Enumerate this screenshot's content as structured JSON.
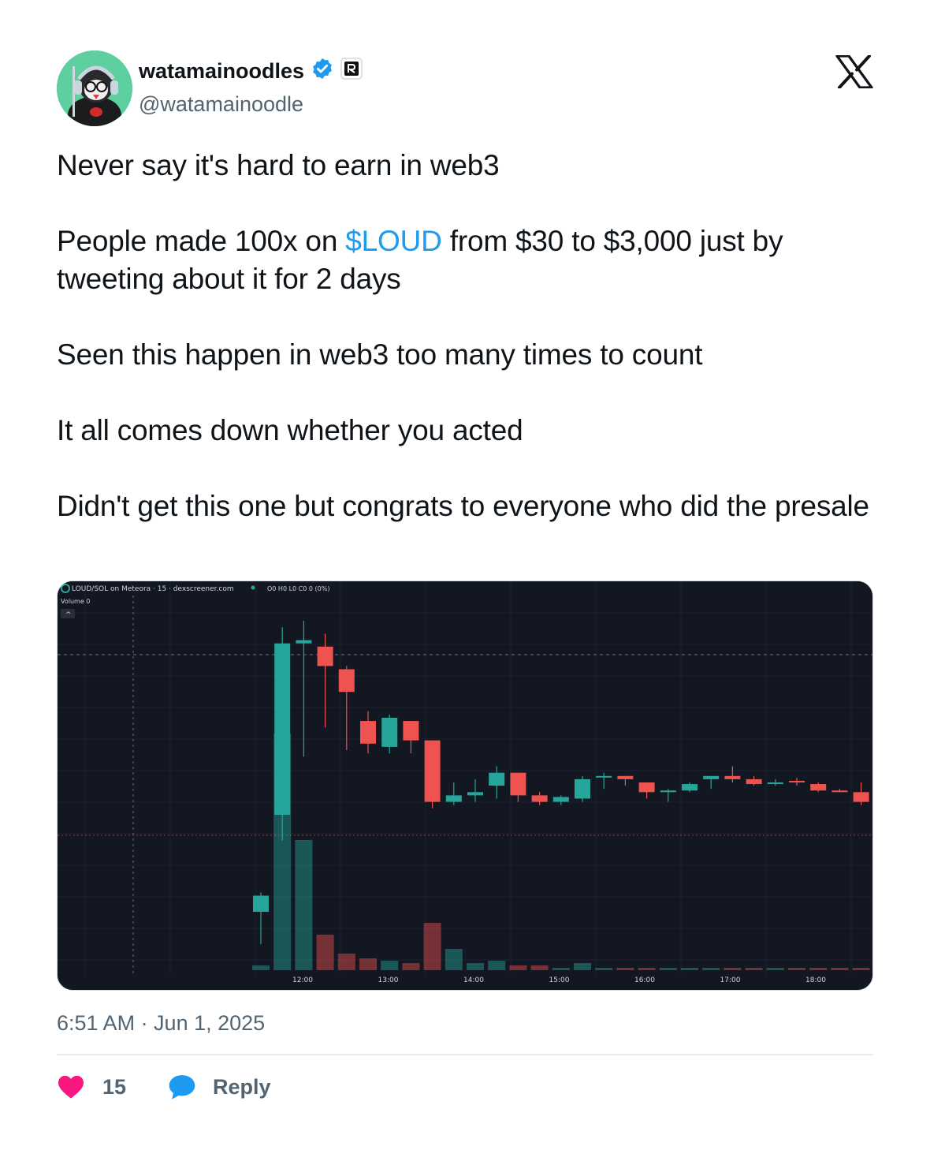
{
  "user": {
    "display_name": "watamainoodles",
    "handle": "@watamainoodle",
    "verified_color": "#1d9bf0",
    "icons": [
      "avatar-penguin",
      "verified-badge-icon",
      "affiliate-badge-icon"
    ]
  },
  "x_logo": "x-logo-icon",
  "tweet": {
    "line1": "Never say it's hard to earn in web3",
    "p2_before": "People made 100x on ",
    "p2_cashtag": "$LOUD",
    "p2_after": " from $30 to $3,000 just by tweeting about it for 2 days",
    "line3": "Seen this happen in web3 too many times to count",
    "line4": "It all comes down whether you acted",
    "line5": "Didn't get this one but congrats to everyone who did the presale",
    "cashtag_color": "#1d9bf0"
  },
  "chart_header": {
    "pair": "LOUD/SOL on Meteora · 15 · dexscreener.com",
    "ohlc": "O0 H0 L0 C0 0 (0%)",
    "volume": "Volume  0",
    "collapse": "^"
  },
  "chart_data": {
    "type": "candlestick",
    "x_ticks": [
      "12:00",
      "13:00",
      "14:00",
      "15:00",
      "16:00",
      "17:00",
      "18:00"
    ],
    "up_color": "#26a69a",
    "down_color": "#ef5350",
    "background": "#131722",
    "grid": true,
    "candles": [
      {
        "o": 1.0,
        "h": 1.6,
        "l": 0.0,
        "c": 1.5,
        "dir": "up"
      },
      {
        "o": 4.0,
        "h": 9.8,
        "l": 3.2,
        "c": 9.3,
        "dir": "up"
      },
      {
        "o": 9.3,
        "h": 10.0,
        "l": 5.8,
        "c": 9.4,
        "dir": "up"
      },
      {
        "o": 9.2,
        "h": 9.6,
        "l": 6.7,
        "c": 8.6,
        "dir": "down"
      },
      {
        "o": 8.5,
        "h": 8.6,
        "l": 6.0,
        "c": 7.8,
        "dir": "down"
      },
      {
        "o": 6.9,
        "h": 7.2,
        "l": 5.9,
        "c": 6.2,
        "dir": "down"
      },
      {
        "o": 6.1,
        "h": 7.1,
        "l": 5.9,
        "c": 7.0,
        "dir": "up"
      },
      {
        "o": 6.9,
        "h": 6.9,
        "l": 5.9,
        "c": 6.3,
        "dir": "down"
      },
      {
        "o": 6.3,
        "h": 6.3,
        "l": 4.2,
        "c": 4.4,
        "dir": "down"
      },
      {
        "o": 4.4,
        "h": 5.0,
        "l": 4.3,
        "c": 4.6,
        "dir": "up"
      },
      {
        "o": 4.6,
        "h": 5.1,
        "l": 4.4,
        "c": 4.7,
        "dir": "up"
      },
      {
        "o": 4.9,
        "h": 5.5,
        "l": 4.5,
        "c": 5.3,
        "dir": "up"
      },
      {
        "o": 5.3,
        "h": 5.3,
        "l": 4.4,
        "c": 4.6,
        "dir": "down"
      },
      {
        "o": 4.6,
        "h": 4.7,
        "l": 4.3,
        "c": 4.4,
        "dir": "down"
      },
      {
        "o": 4.4,
        "h": 4.6,
        "l": 4.3,
        "c": 4.55,
        "dir": "up"
      },
      {
        "o": 4.5,
        "h": 5.2,
        "l": 4.4,
        "c": 5.1,
        "dir": "up"
      },
      {
        "o": 5.15,
        "h": 5.3,
        "l": 4.8,
        "c": 5.2,
        "dir": "up"
      },
      {
        "o": 5.2,
        "h": 5.2,
        "l": 4.9,
        "c": 5.1,
        "dir": "down"
      },
      {
        "o": 5.0,
        "h": 5.0,
        "l": 4.5,
        "c": 4.7,
        "dir": "down"
      },
      {
        "o": 4.7,
        "h": 4.8,
        "l": 4.4,
        "c": 4.75,
        "dir": "up"
      },
      {
        "o": 4.75,
        "h": 5.0,
        "l": 4.7,
        "c": 4.95,
        "dir": "up"
      },
      {
        "o": 5.1,
        "h": 5.2,
        "l": 4.8,
        "c": 5.2,
        "dir": "up"
      },
      {
        "o": 5.2,
        "h": 5.5,
        "l": 5.0,
        "c": 5.1,
        "dir": "down"
      },
      {
        "o": 5.1,
        "h": 5.2,
        "l": 4.9,
        "c": 4.95,
        "dir": "down"
      },
      {
        "o": 4.95,
        "h": 5.1,
        "l": 4.9,
        "c": 5.0,
        "dir": "up"
      },
      {
        "o": 5.05,
        "h": 5.15,
        "l": 4.9,
        "c": 5.0,
        "dir": "down"
      },
      {
        "o": 4.95,
        "h": 5.0,
        "l": 4.7,
        "c": 4.75,
        "dir": "down"
      },
      {
        "o": 4.75,
        "h": 4.8,
        "l": 4.7,
        "c": 4.72,
        "dir": "down"
      },
      {
        "o": 4.7,
        "h": 5.0,
        "l": 4.3,
        "c": 4.4,
        "dir": "down"
      }
    ],
    "volumes": [
      {
        "v": 0.02,
        "dir": "up"
      },
      {
        "v": 1.0,
        "dir": "up"
      },
      {
        "v": 0.55,
        "dir": "up"
      },
      {
        "v": 0.15,
        "dir": "down"
      },
      {
        "v": 0.07,
        "dir": "down"
      },
      {
        "v": 0.05,
        "dir": "down"
      },
      {
        "v": 0.04,
        "dir": "up"
      },
      {
        "v": 0.03,
        "dir": "down"
      },
      {
        "v": 0.2,
        "dir": "down"
      },
      {
        "v": 0.09,
        "dir": "up"
      },
      {
        "v": 0.03,
        "dir": "up"
      },
      {
        "v": 0.04,
        "dir": "up"
      },
      {
        "v": 0.02,
        "dir": "down"
      },
      {
        "v": 0.02,
        "dir": "down"
      },
      {
        "v": 0.01,
        "dir": "up"
      },
      {
        "v": 0.03,
        "dir": "up"
      },
      {
        "v": 0.01,
        "dir": "up"
      },
      {
        "v": 0.01,
        "dir": "down"
      },
      {
        "v": 0.01,
        "dir": "down"
      },
      {
        "v": 0.01,
        "dir": "up"
      },
      {
        "v": 0.01,
        "dir": "up"
      },
      {
        "v": 0.01,
        "dir": "up"
      },
      {
        "v": 0.01,
        "dir": "down"
      },
      {
        "v": 0.01,
        "dir": "down"
      },
      {
        "v": 0.01,
        "dir": "up"
      },
      {
        "v": 0.01,
        "dir": "down"
      },
      {
        "v": 0.01,
        "dir": "down"
      },
      {
        "v": 0.01,
        "dir": "down"
      },
      {
        "v": 0.01,
        "dir": "down"
      }
    ]
  },
  "meta": {
    "timestamp": "6:51 AM · Jun 1, 2025"
  },
  "actions": {
    "likes": "15",
    "reply": "Reply",
    "like_color": "#f91880",
    "reply_color": "#1d9bf0"
  }
}
